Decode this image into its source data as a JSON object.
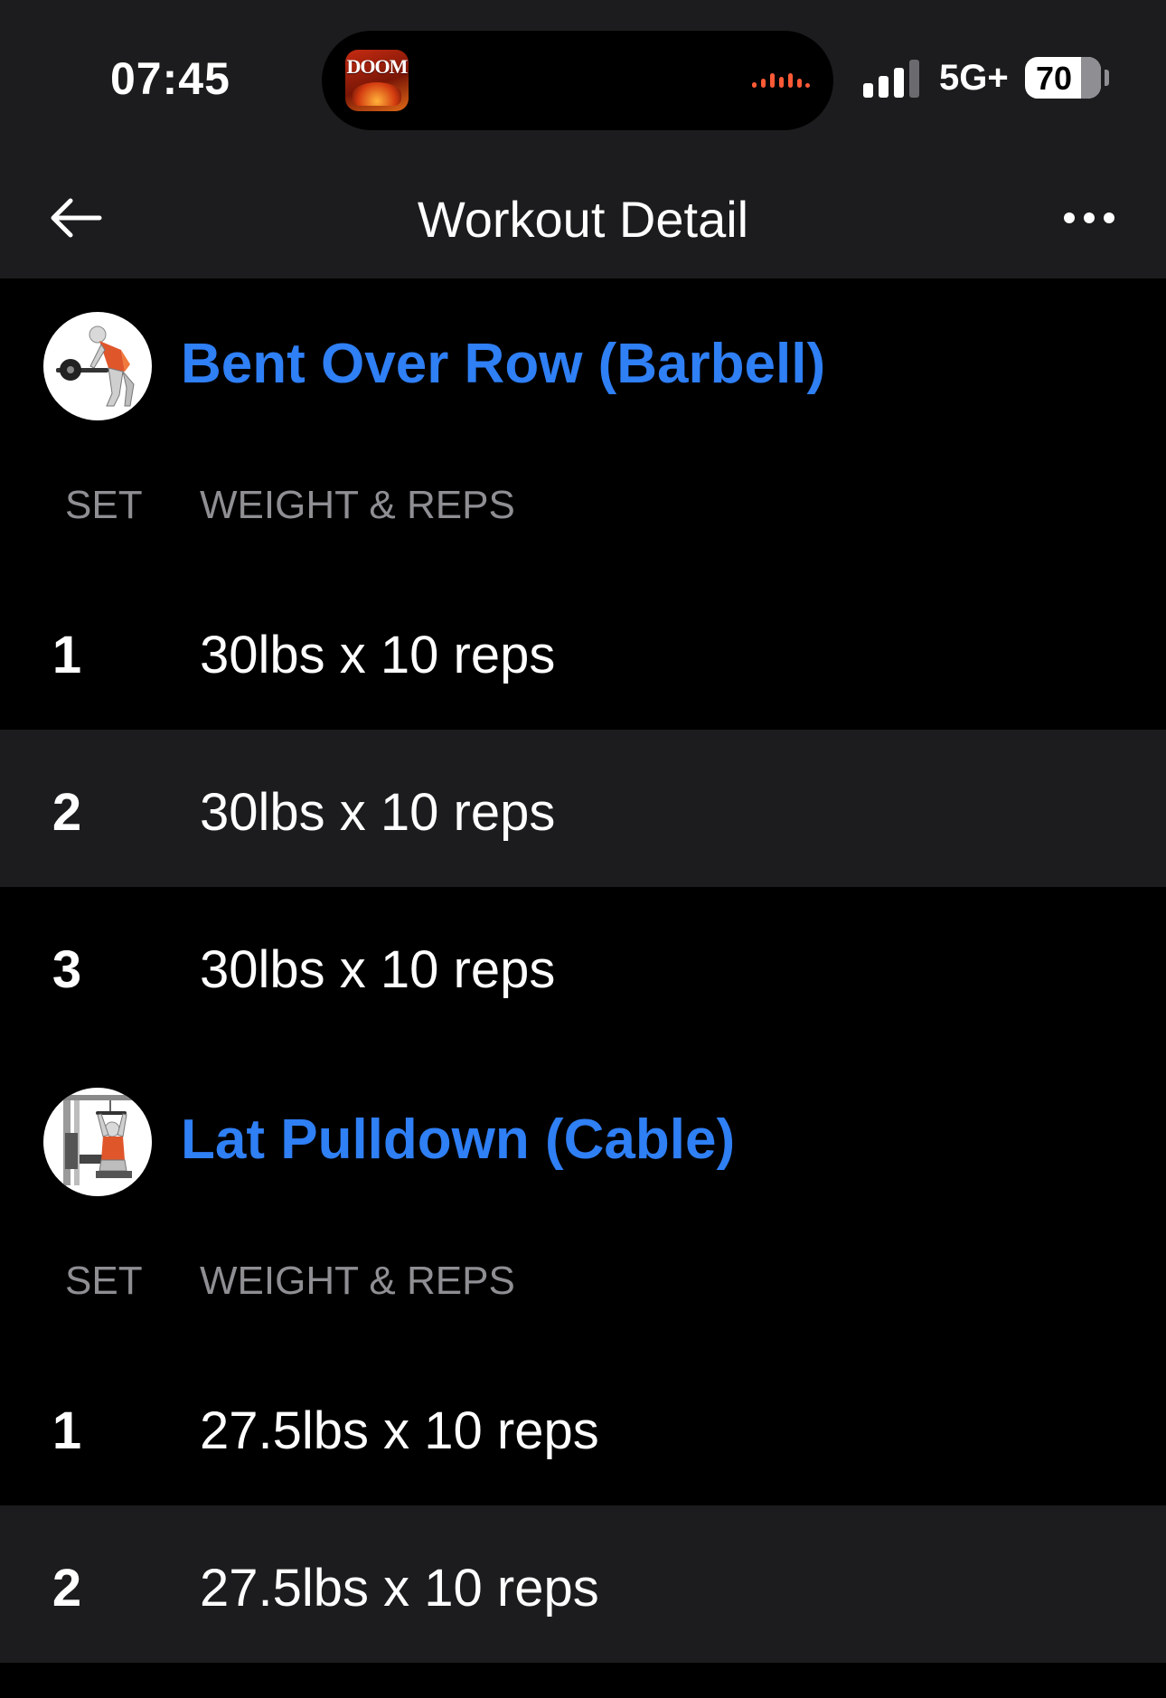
{
  "status_bar": {
    "time": "07:45",
    "live_activity_app": "DOOM",
    "network": "5G+",
    "battery": "70"
  },
  "nav": {
    "title": "Workout Detail"
  },
  "columns": {
    "set": "SET",
    "weight_reps": "WEIGHT & REPS"
  },
  "exercises": [
    {
      "name": "Bent Over Row (Barbell)",
      "sets": [
        {
          "set": "1",
          "value": "30lbs x 10 reps"
        },
        {
          "set": "2",
          "value": "30lbs x 10 reps"
        },
        {
          "set": "3",
          "value": "30lbs x 10 reps"
        }
      ]
    },
    {
      "name": "Lat Pulldown (Cable)",
      "sets": [
        {
          "set": "1",
          "value": "27.5lbs x 10 reps"
        },
        {
          "set": "2",
          "value": "27.5lbs x 10 reps"
        }
      ]
    }
  ],
  "colors": {
    "accent": "#2f7ff5",
    "background": "#000000",
    "surface": "#1c1c1e",
    "muted_text": "#8e8e93"
  }
}
